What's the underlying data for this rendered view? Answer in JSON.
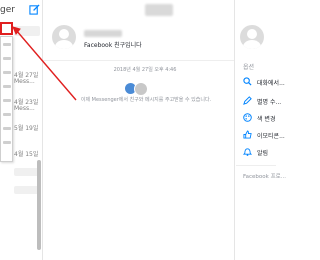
{
  "sidebar": {
    "title_fragment": "ger",
    "compose_icon": "compose-icon",
    "dates": [
      "4월 27일",
      "4월 23일",
      "5월 19일",
      "4월 15일"
    ],
    "previews": [
      "Mess...",
      "Mess..."
    ]
  },
  "conversation": {
    "friend_label": "Facebook 친구입니다",
    "timestamp": "2018년 4월 27일 오후 4:46",
    "connect_message": "이제 Messenger에서 친구와 메시지를 주고받을 수 있습니다."
  },
  "right_panel": {
    "options_heading": "옵션",
    "options": [
      {
        "label": "대화에서...",
        "icon": "search-icon"
      },
      {
        "label": "별명 수...",
        "icon": "pencil-icon"
      },
      {
        "label": "색 변경",
        "icon": "palette-icon"
      },
      {
        "label": "이모티콘...",
        "icon": "thumbs-up-icon"
      },
      {
        "label": "알림",
        "icon": "bell-icon"
      }
    ],
    "facebook_profile": "Facebook 프로..."
  },
  "colors": {
    "accent": "#0084ff",
    "highlight": "#e02020"
  }
}
